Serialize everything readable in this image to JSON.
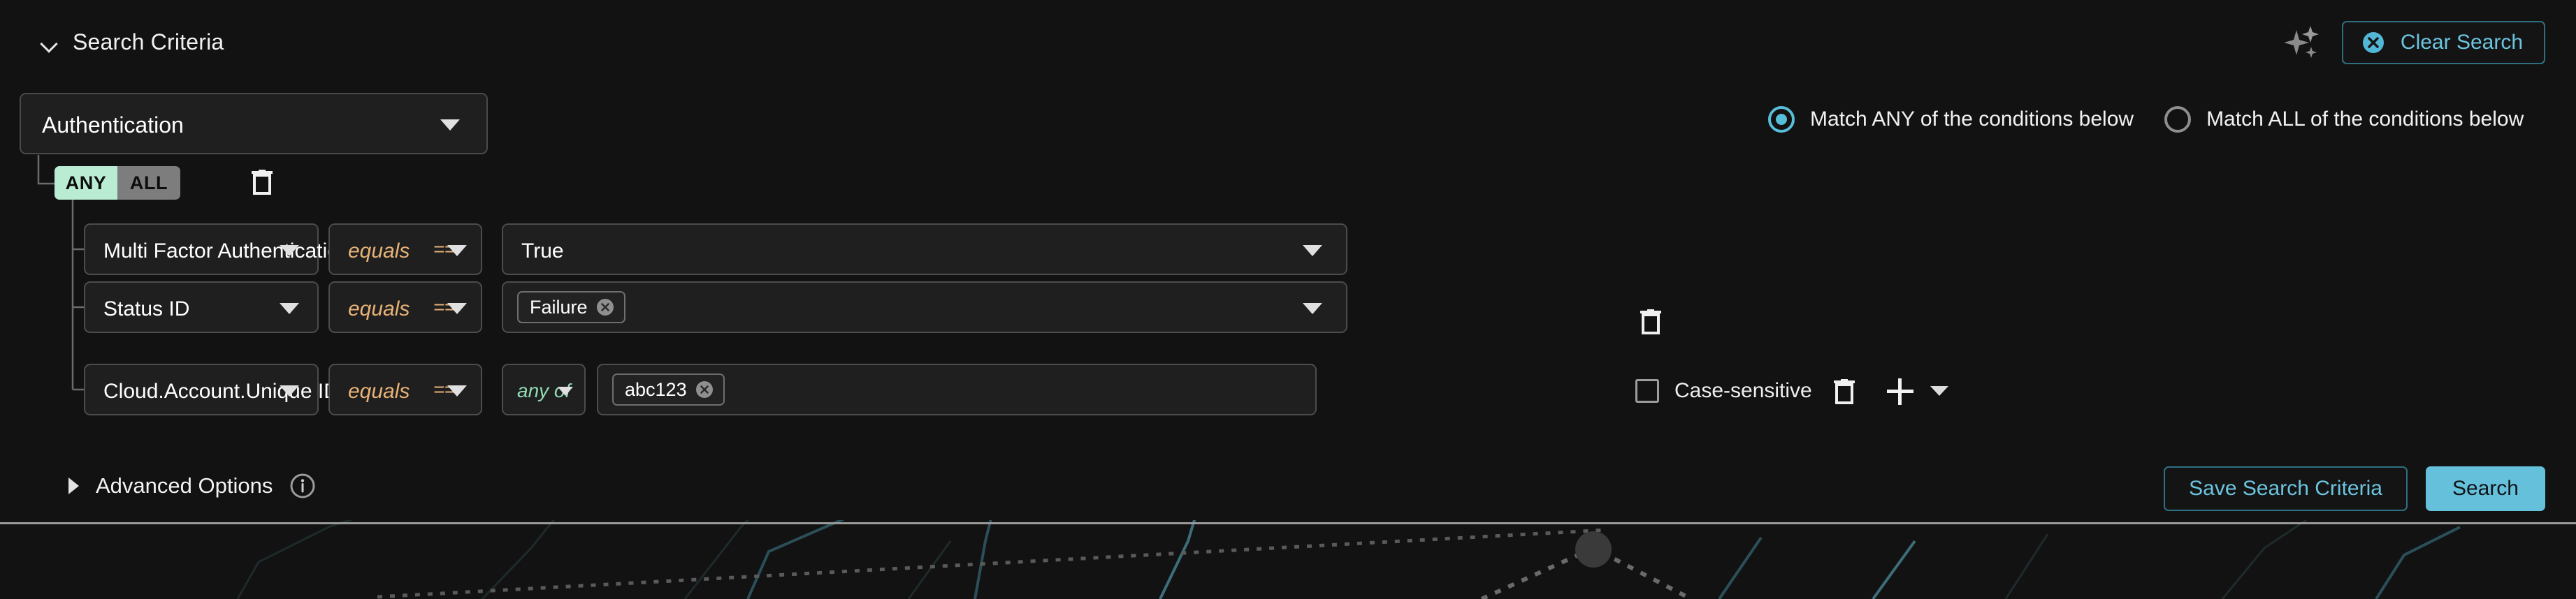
{
  "header": {
    "title": "Search Criteria",
    "collapse_icon": "chevron-down-icon",
    "sparkles_icon": "sparkles-icon",
    "clear_search_label": "Clear Search",
    "clear_search_icon": "circle-x-icon"
  },
  "match_mode": {
    "options": [
      {
        "label": "Match ANY of the conditions below",
        "selected": true
      },
      {
        "label": "Match ALL of the conditions below",
        "selected": false
      }
    ]
  },
  "group": {
    "type_value": "Authentication",
    "dropdown_icon": "triangle-down-icon",
    "logic_toggle": {
      "any_label": "ANY",
      "all_label": "ALL",
      "active": "ANY"
    },
    "delete_icon": "trash-icon"
  },
  "conditions": [
    {
      "attribute": "Multi Factor Authentication",
      "operator_label": "equals",
      "operator_symbol": "==",
      "value": "True",
      "value_kind": "select"
    },
    {
      "attribute": "Status ID",
      "operator_label": "equals",
      "operator_symbol": "==",
      "chips": [
        "Failure"
      ],
      "value_kind": "chips-select",
      "delete_icon": "trash-icon"
    },
    {
      "attribute": "Cloud.Account.Unique ID",
      "operator_label": "equals",
      "operator_symbol": "==",
      "match_any_label": "any of",
      "chips": [
        "abc123"
      ],
      "value_kind": "chips-input",
      "case_sensitive_label": "Case-sensitive",
      "case_sensitive_checked": false,
      "delete_icon": "trash-icon",
      "add_icon": "plus-icon",
      "add_menu_icon": "triangle-down-icon"
    }
  ],
  "footer": {
    "advanced_options_label": "Advanced Options",
    "advanced_expand_icon": "triangle-right-icon",
    "advanced_info_icon": "info-circle-icon",
    "save_label": "Save Search Criteria",
    "search_label": "Search"
  },
  "colors": {
    "page_bg": "#121212",
    "field_bg": "#1f1f1f",
    "field_border": "#4c4c4c",
    "accent_cyan": "#65c0dc",
    "accent_cyan_border": "#2f6f82",
    "operator_orange": "#e8b277",
    "any_of_green": "#92dcb4",
    "toggle_active_green": "#b9ecd2",
    "toggle_inactive_gray": "#7d7d7d",
    "text_primary": "#ffffff",
    "divider": "#9a9a9a"
  }
}
